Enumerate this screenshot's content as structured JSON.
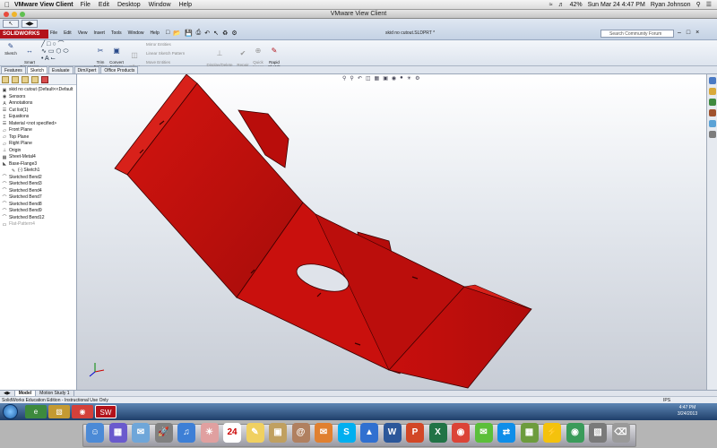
{
  "mac_menubar": {
    "app_name": "VMware View Client",
    "menus": [
      "File",
      "Edit",
      "Desktop",
      "Window",
      "Help"
    ],
    "battery": "42%",
    "datetime": "Sun Mar 24  4:47 PM",
    "user": "Ryan Johnson"
  },
  "vm_window": {
    "title": "VMware View Client"
  },
  "solidworks": {
    "logo": "SOLIDWORKS",
    "menus": [
      "File",
      "Edit",
      "View",
      "Insert",
      "Tools",
      "Window",
      "Help"
    ],
    "document_title": "skid no cutout.SLDPRT *",
    "search_placeholder": "Search Community Forum",
    "commands": [
      {
        "label": "Sketch",
        "icon": "sketch-icon"
      },
      {
        "label": "Smart\nDimension",
        "icon": "dimension-icon"
      },
      {
        "label": "Trim\nEntities",
        "icon": "trim-icon"
      },
      {
        "label": "Convert\nEntities",
        "icon": "convert-icon"
      },
      {
        "label": "Offset\nEntities",
        "icon": "offset-icon"
      },
      {
        "label": "Display/Delete\nRelations",
        "icon": "relations-icon"
      },
      {
        "label": "Repair\nSketch",
        "icon": "repair-icon"
      },
      {
        "label": "Quick\nSnaps",
        "icon": "snap-icon"
      },
      {
        "label": "Rapid\nSketch",
        "icon": "rapid-sketch-icon"
      }
    ],
    "small_tools": [
      "Mirror Entities",
      "Linear Sketch Pattern",
      "Move Entities"
    ],
    "tabs": [
      "Features",
      "Sketch",
      "Evaluate",
      "DimXpert",
      "Office Products"
    ],
    "active_tab": "Sketch",
    "tree": [
      {
        "label": "skid no cutout  (Default<<Default",
        "icon": "part-icon",
        "gray": false
      },
      {
        "label": "Sensors",
        "icon": "sensor-icon",
        "gray": false
      },
      {
        "label": "Annotations",
        "icon": "annotation-icon",
        "gray": false
      },
      {
        "label": "Cut list(1)",
        "icon": "cutlist-icon",
        "gray": false
      },
      {
        "label": "Equations",
        "icon": "equation-icon",
        "gray": false
      },
      {
        "label": "Material <not specified>",
        "icon": "material-icon",
        "gray": false
      },
      {
        "label": "Front Plane",
        "icon": "plane-icon",
        "gray": false
      },
      {
        "label": "Top Plane",
        "icon": "plane-icon",
        "gray": false
      },
      {
        "label": "Right Plane",
        "icon": "plane-icon",
        "gray": false
      },
      {
        "label": "Origin",
        "icon": "origin-icon",
        "gray": false
      },
      {
        "label": "Sheet-Metal4",
        "icon": "sheetmetal-icon",
        "gray": false
      },
      {
        "label": "Base-Flange3",
        "icon": "flange-icon",
        "gray": false
      },
      {
        "label": "(-) Sketch1",
        "icon": "sketch-icon",
        "gray": false
      },
      {
        "label": "Sketched Bend2",
        "icon": "bend-icon",
        "gray": false
      },
      {
        "label": "Sketched Bend3",
        "icon": "bend-icon",
        "gray": false
      },
      {
        "label": "Sketched Bend4",
        "icon": "bend-icon",
        "gray": false
      },
      {
        "label": "Sketched Bend7",
        "icon": "bend-icon",
        "gray": false
      },
      {
        "label": "Sketched Bend8",
        "icon": "bend-icon",
        "gray": false
      },
      {
        "label": "Sketched Bend9",
        "icon": "bend-icon",
        "gray": false
      },
      {
        "label": "Sketched Bend12",
        "icon": "bend-icon",
        "gray": false
      },
      {
        "label": "Flat-Pattern4",
        "icon": "flat-pattern-icon",
        "gray": true
      }
    ],
    "model_tabs": [
      "Model",
      "Motion Study 1"
    ],
    "active_model_tab": "Model",
    "status_text": "SolidWorks Education Edition - Instructional Use Only",
    "units": "IPS",
    "part_color": "#c5100e"
  },
  "windows_taskbar": {
    "time": "4:47 PM",
    "date": "3/24/2013"
  },
  "dock": {
    "items": [
      "finder-icon",
      "mission-control-icon",
      "mail-icon",
      "rocket-icon",
      "itunes-icon",
      "photos-icon",
      "calendar-icon",
      "notes-icon",
      "preview-icon",
      "contacts-icon",
      "ibooks-icon",
      "skype-icon",
      "keynote-icon",
      "word-icon",
      "powerpoint-icon",
      "excel-icon",
      "chrome-icon",
      "messages-icon",
      "teamviewer-icon",
      "vmware-icon",
      "lightning-icon",
      "vmware-view-icon",
      "documents-icon",
      "trash-icon"
    ],
    "calendar_day": "24"
  }
}
